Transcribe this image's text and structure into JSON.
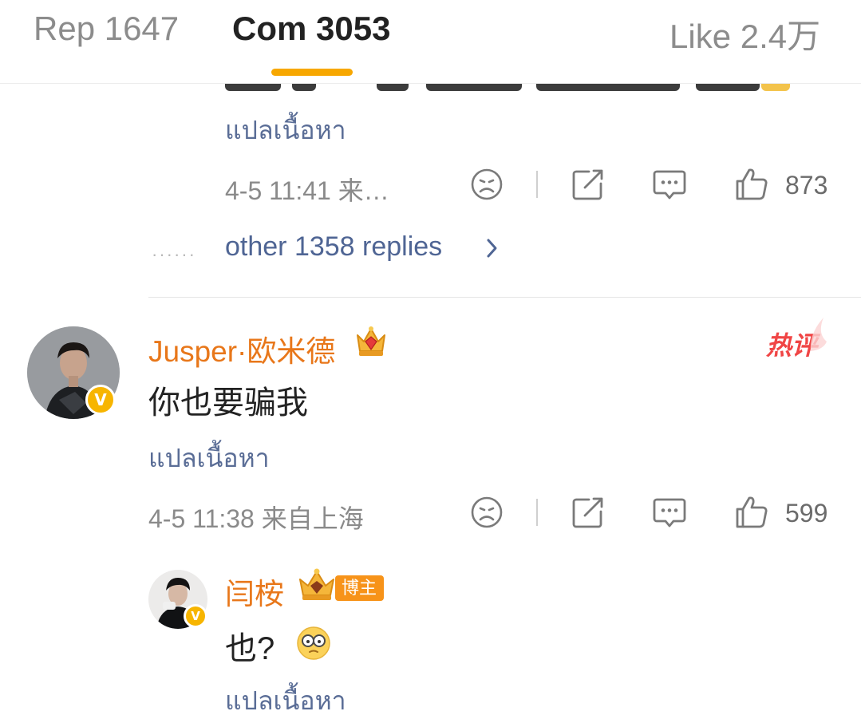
{
  "tabs": {
    "reposts": "Rep 1647",
    "comments": "Com 3053",
    "likes": "Like 2.4万"
  },
  "accent_color": "#f7a700",
  "username_color": "#e8771a",
  "link_color": "#4f6594",
  "prev_comment": {
    "translate": "แปลเนื้อหา",
    "meta": "4-5 11:41  来…",
    "like_count": "873",
    "more_replies": "other 1358 replies"
  },
  "comment": {
    "username": "Jusper·欧米德",
    "hot_tag": "热评",
    "text": "你也要骗我",
    "translate": "แปลเนื้อหา",
    "meta": "4-5 11:38  来自上海",
    "like_count": "599",
    "badge_letter": "V"
  },
  "reply": {
    "username": "闫桉",
    "blogger_tag": "博主",
    "text": "也?",
    "translate": "แปลเนื้อหา",
    "badge_letter": "V"
  },
  "icons": [
    "dislike-icon",
    "repost-icon",
    "comment-icon",
    "like-icon",
    "chevron-right-icon",
    "crown-icon",
    "emoji-icon"
  ]
}
